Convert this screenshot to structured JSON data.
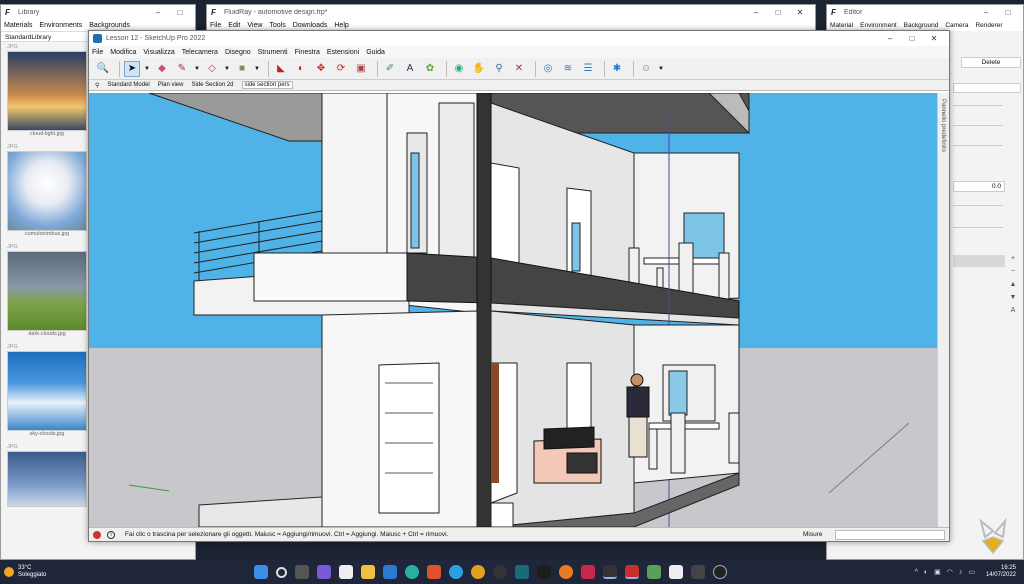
{
  "library": {
    "title": "Library",
    "tabs": [
      "Materials",
      "Environments",
      "Backgrounds"
    ],
    "section": "StandardLibrary",
    "items": [
      {
        "tag": "JPG",
        "name": "cloud-light.jpg"
      },
      {
        "tag": "JPG",
        "name": "cumulonimbus.jpg"
      },
      {
        "tag": "JPG",
        "name": "dark-clouds.jpg"
      },
      {
        "tag": "JPG",
        "name": "sky-clouds.jpg"
      },
      {
        "tag": "JPG",
        "name": ""
      }
    ]
  },
  "fluid": {
    "title": "FluidRay - automotive design.frp*",
    "menu": [
      "File",
      "Edit",
      "View",
      "Tools",
      "Downloads",
      "Help"
    ]
  },
  "editor": {
    "title": "Editor",
    "tabs": [
      "Material",
      "Environment",
      "Background",
      "Camera",
      "Renderer"
    ],
    "delete_label": "Delete",
    "value": "0.0"
  },
  "sketchup": {
    "title": "Lesson 12 - SketchUp Pro 2022",
    "menu": [
      "File",
      "Modifica",
      "Visualizza",
      "Telecamera",
      "Disegno",
      "Strumenti",
      "Finestra",
      "Estensioni",
      "Guida"
    ],
    "scenes": [
      "Standard Model",
      "Plan view",
      "Side Section 2d",
      "side section pers"
    ],
    "tray_label": "Pannello predefinito",
    "status_text": "Fai clic o trascina per selezionare gli oggetti. Maiusc = Aggiungi/rimuovi. Ctrl = Aggiungi. Maiusc + Ctrl = rimuovi.",
    "measure_label": "Misure"
  },
  "taskbar": {
    "temperature": "33°C",
    "condition": "Soleggiato",
    "time": "16:25",
    "date": "14/07/2022"
  },
  "colors": {
    "sky": "#4fb3e8",
    "ground": "#c8c8cc",
    "taskbar": "#20263a",
    "weather_sun": "#f5a623"
  }
}
